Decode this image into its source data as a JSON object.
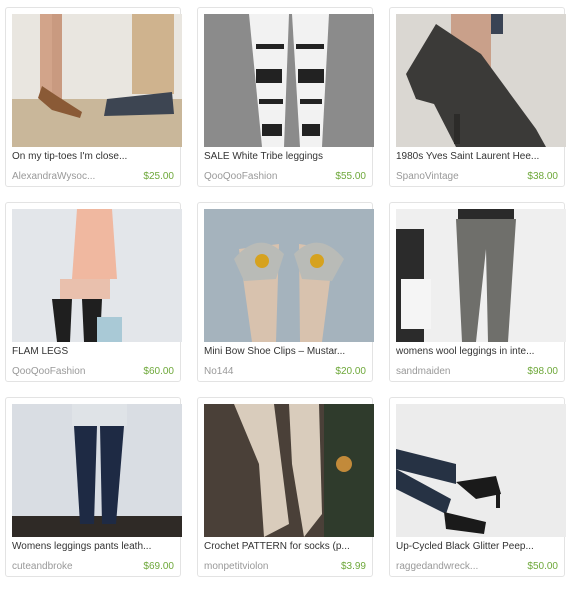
{
  "listings": [
    {
      "title": "On my tip-toes I'm close...",
      "shop": "AlexandraWysoc...",
      "price": "$25.00"
    },
    {
      "title": "SALE White Tribe leggings",
      "shop": "QooQooFashion",
      "price": "$55.00"
    },
    {
      "title": "1980s Yves Saint Laurent Hee...",
      "shop": "SpanoVintage",
      "price": "$38.00"
    },
    {
      "title": "FLAM LEGS",
      "shop": "QooQooFashion",
      "price": "$60.00"
    },
    {
      "title": "Mini Bow Shoe Clips – Mustar...",
      "shop": "No144",
      "price": "$20.00"
    },
    {
      "title": "womens wool leggings in inte...",
      "shop": "sandmaiden",
      "price": "$98.00"
    },
    {
      "title": "Womens leggings pants leath...",
      "shop": "cuteandbroke",
      "price": "$69.00"
    },
    {
      "title": "Crochet PATTERN for socks (p...",
      "shop": "monpetitviolon",
      "price": "$3.99"
    },
    {
      "title": "Up-Cycled Black Glitter Peep...",
      "shop": "raggedandwreck...",
      "price": "$50.00"
    }
  ],
  "colors": {
    "price": "#6ea83a",
    "shop": "#999999",
    "title": "#333333",
    "border": "#e3e3e3"
  }
}
